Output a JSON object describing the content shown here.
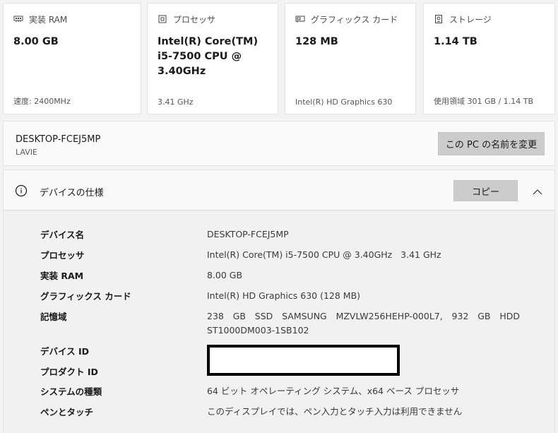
{
  "cards": [
    {
      "title": "実装 RAM",
      "icon": "ram-icon",
      "value": "8.00 GB",
      "footer": "速度: 2400MHz"
    },
    {
      "title": "プロセッサ",
      "icon": "processor-icon",
      "value": "Intel(R) Core(TM) i5-7500 CPU @ 3.40GHz",
      "footer": "3.41 GHz"
    },
    {
      "title": "グラフィックス カード",
      "icon": "graphics-card-icon",
      "value": "128 MB",
      "footer": "Intel(R) HD Graphics 630"
    },
    {
      "title": "ストレージ",
      "icon": "storage-icon",
      "value": "1.14 TB",
      "footer": "使用領域 301 GB / 1.14 TB"
    }
  ],
  "pc": {
    "name": "DESKTOP-FCEJ5MP",
    "model": "LAVIE",
    "rename_label": "この PC の名前を変更"
  },
  "spec": {
    "title": "デバイスの仕様",
    "copy_label": "コピー",
    "rows": [
      {
        "label": "デバイス名",
        "value": "DESKTOP-FCEJ5MP"
      },
      {
        "label": "プロセッサ",
        "value": "Intel(R) Core(TM) i5-7500 CPU @ 3.40GHz   3.41 GHz"
      },
      {
        "label": "実装 RAM",
        "value": "8.00 GB"
      },
      {
        "label": "グラフィックス カード",
        "value": "Intel(R) HD Graphics 630 (128 MB)"
      },
      {
        "label": "記憶域",
        "value": "238 GB SSD SAMSUNG MZVLW256HEHP-000L7, 932 GB HDD ST1000DM003-1SB102"
      },
      {
        "label": "デバイス ID",
        "value": ""
      },
      {
        "label": "プロダクト ID",
        "value": ""
      },
      {
        "label": "システムの種類",
        "value": "64 ビット オペレーティング システム、x64 ベース プロセッサ"
      },
      {
        "label": "ペンとタッチ",
        "value": "このディスプレイでは、ペン入力とタッチ入力は利用できません"
      }
    ]
  },
  "colors": {
    "background": "#f3f3f3",
    "card": "#ffffff",
    "button": "#cccccc",
    "redaction_border": "#000000"
  }
}
